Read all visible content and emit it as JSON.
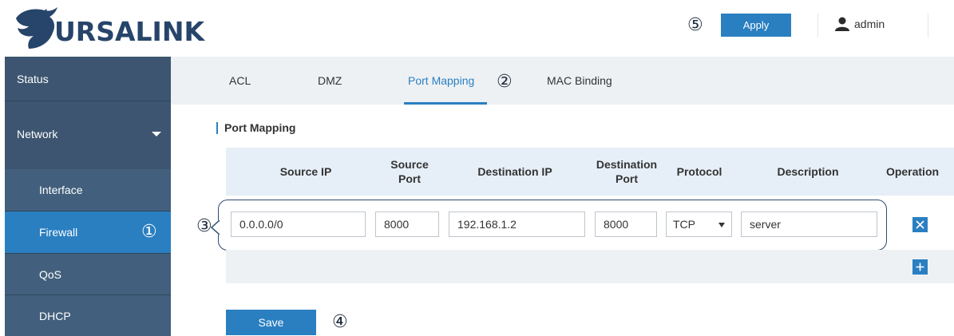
{
  "header": {
    "brand": "URSALINK",
    "step_marker": "⑤",
    "apply_label": "Apply",
    "user_name": "admin"
  },
  "sidebar": {
    "items": [
      {
        "label": "Status",
        "type": "main"
      },
      {
        "label": "Network",
        "type": "main",
        "expanded": true
      },
      {
        "label": "Interface",
        "type": "sub"
      },
      {
        "label": "Firewall",
        "type": "sub",
        "active": true
      },
      {
        "label": "QoS",
        "type": "sub"
      },
      {
        "label": "DHCP",
        "type": "sub"
      }
    ],
    "step_marker": "①"
  },
  "tabs": {
    "items": [
      {
        "label": "ACL"
      },
      {
        "label": "DMZ"
      },
      {
        "label": "Port Mapping",
        "active": true
      },
      {
        "label": "MAC Binding"
      }
    ],
    "step_marker": "②"
  },
  "section": {
    "title": "Port Mapping"
  },
  "table": {
    "headers": {
      "source_ip": "Source IP",
      "source_port": [
        "Source",
        "Port"
      ],
      "destination_ip": "Destination IP",
      "destination_port": [
        "Destination",
        "Port"
      ],
      "protocol": "Protocol",
      "description": "Description",
      "operation": "Operation"
    },
    "rows": [
      {
        "source_ip": "0.0.0.0/0",
        "source_port": "8000",
        "destination_ip": "192.168.1.2",
        "destination_port": "8000",
        "protocol": "TCP",
        "description": "server"
      }
    ],
    "row_step_marker": "③"
  },
  "actions": {
    "save_label": "Save",
    "save_step_marker": "④"
  },
  "colors": {
    "accent": "#2a7fc1",
    "sidebar": "#3d5570",
    "brand": "#27456a"
  },
  "icons": {
    "logo": "ursalink-bear-logo",
    "user": "user-icon",
    "delete": "close-icon",
    "add": "plus-icon",
    "expand": "caret-down-icon"
  }
}
